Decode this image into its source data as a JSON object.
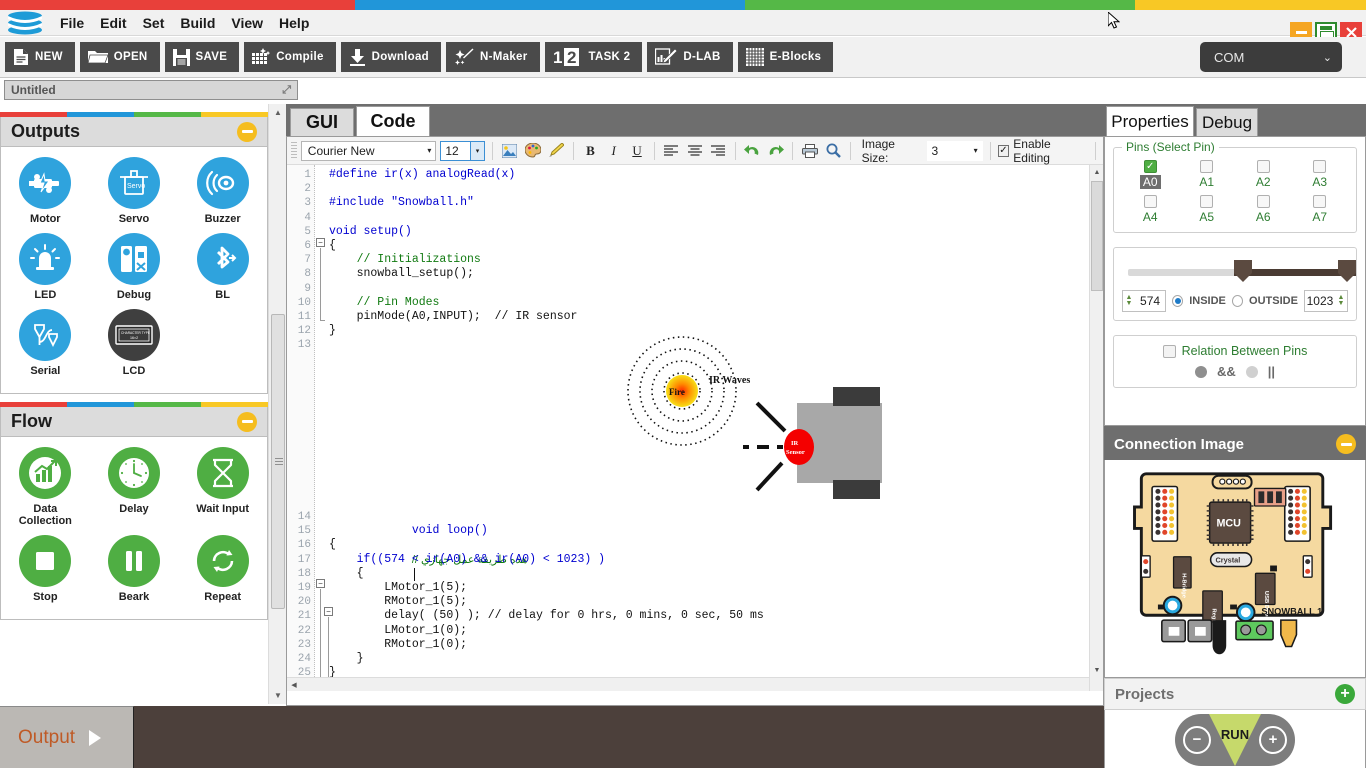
{
  "window": {
    "minimize_label": "–",
    "maximize_label": "□",
    "close_label": "✕"
  },
  "menubar": {
    "items": [
      {
        "label": "File"
      },
      {
        "label": "Edit"
      },
      {
        "label": "Set"
      },
      {
        "label": "Build"
      },
      {
        "label": "View"
      },
      {
        "label": "Help"
      }
    ]
  },
  "toolbar": {
    "buttons": [
      {
        "label": "NEW",
        "icon": "new-file-icon"
      },
      {
        "label": "OPEN",
        "icon": "folder-icon"
      },
      {
        "label": "SAVE",
        "icon": "floppy-icon"
      },
      {
        "label": "Compile",
        "icon": "compile-grid-icon"
      },
      {
        "label": "Download",
        "icon": "download-icon"
      },
      {
        "label": "N-Maker",
        "icon": "wand-icon"
      },
      {
        "label": "TASK 2",
        "icon": "task-number-icon"
      },
      {
        "label": "D-LAB",
        "icon": "chart-pencil-icon"
      },
      {
        "label": "E-Blocks",
        "icon": "blocks-grid-icon"
      }
    ],
    "com": {
      "value": "COM",
      "chevron": "⌄"
    }
  },
  "file_tab": {
    "title": "Untitled",
    "resize_glyph": "⤢"
  },
  "left_panel": {
    "groups": [
      {
        "title": "Outputs",
        "collapse_icon": "minus-icon",
        "items": [
          {
            "label": "Motor",
            "icon": "motor-icon",
            "style": "blue"
          },
          {
            "label": "Servo",
            "icon": "servo-icon",
            "style": "blue"
          },
          {
            "label": "Buzzer",
            "icon": "buzzer-icon",
            "style": "blue"
          },
          {
            "label": "LED",
            "icon": "led-icon",
            "style": "blue"
          },
          {
            "label": "Debug",
            "icon": "debug-icon",
            "style": "blue"
          },
          {
            "label": "BL",
            "icon": "bluetooth-icon",
            "style": "blue"
          },
          {
            "label": "Serial",
            "icon": "serial-icon",
            "style": "blue"
          },
          {
            "label": "LCD",
            "icon": "lcd-icon",
            "style": "dark"
          }
        ]
      },
      {
        "title": "Flow",
        "collapse_icon": "minus-icon",
        "items": [
          {
            "label": "Data\nCollection",
            "icon": "data-collection-icon",
            "style": "green"
          },
          {
            "label": "Delay",
            "icon": "clock-icon",
            "style": "green"
          },
          {
            "label": "Wait Input",
            "icon": "hourglass-icon",
            "style": "green"
          },
          {
            "label": "Stop",
            "icon": "stop-square-icon",
            "style": "green"
          },
          {
            "label": "Beark",
            "icon": "pause-icon",
            "style": "green"
          },
          {
            "label": "Repeat",
            "icon": "repeat-arrows-icon",
            "style": "green"
          }
        ]
      }
    ]
  },
  "editor": {
    "tabs": [
      {
        "label": "GUI",
        "active": false
      },
      {
        "label": "Code",
        "active": true
      }
    ],
    "toolbar": {
      "font_family": "Courier New",
      "font_size": "12",
      "insert_image_icon": "insert-image-icon",
      "color_icon": "palette-icon",
      "highlight_icon": "brush-icon",
      "bold_label": "B",
      "italic_label": "I",
      "underline_label": "U",
      "align_left_icon": "align-left-icon",
      "align_center_icon": "align-center-icon",
      "align_right_icon": "align-right-icon",
      "undo_icon": "undo-icon",
      "redo_icon": "redo-icon",
      "print_icon": "print-icon",
      "zoom_icon": "magnifier-icon",
      "image_size_label": "Image Size:",
      "image_size_value": "3",
      "enable_editing_label": "Enable Editing",
      "enable_editing_checked": true,
      "check_glyph": "✓",
      "dropdown_glyph": "▾"
    },
    "line_numbers_top": [
      "1",
      "2",
      "3",
      "4",
      "5",
      "6",
      "7",
      "8",
      "9",
      "10",
      "11",
      "12",
      "13"
    ],
    "line_numbers_bottom": [
      "14",
      "15",
      "16",
      "17",
      "18",
      "19",
      "20",
      "21",
      "22",
      "23",
      "24",
      "25"
    ],
    "code_top": [
      "#define ir(x) analogRead(x)",
      "",
      "#include \"Snowball.h\"",
      "",
      "void setup()",
      "{",
      "    // Initializations",
      "    snowball_setup();",
      "",
      "    // Pin Modes",
      "    pinMode(A0,INPUT);  // IR sensor",
      "}",
      ""
    ],
    "code_bottom": [
      "void loop()",
      "",
      "{",
      "    if((574 < ir(A0) && ir(A0) < 1023) )",
      "    {",
      "        LMotor_1(5);",
      "        RMotor_1(5);",
      "        delay( (50) ); // delay for 0 hrs, 0 mins, 0 sec, 50 ms",
      "        LMotor_1(0);",
      "        RMotor_1(0);",
      "    }",
      "}"
    ],
    "arabic_comment": "هذه طريقة عمل جهازي //",
    "diagram": {
      "fire_label": "Fire",
      "waves_label": "IR Waves",
      "sensor_label_line1": "IR",
      "sensor_label_line2": "Sensor"
    }
  },
  "properties": {
    "tabs": [
      {
        "label": "Properties",
        "active": true
      },
      {
        "label": "Debug",
        "active": false
      }
    ],
    "pins": {
      "legend": "Pins (Select Pin)",
      "check_glyph": "✓",
      "row1": [
        {
          "label": "A0",
          "checked": true,
          "selected": true
        },
        {
          "label": "A1",
          "checked": false,
          "selected": false
        },
        {
          "label": "A2",
          "checked": false,
          "selected": false
        },
        {
          "label": "A3",
          "checked": false,
          "selected": false
        }
      ],
      "row2": [
        {
          "label": "A4",
          "checked": false,
          "selected": false
        },
        {
          "label": "A5",
          "checked": false,
          "selected": false
        },
        {
          "label": "A6",
          "checked": false,
          "selected": false
        },
        {
          "label": "A7",
          "checked": false,
          "selected": false
        }
      ]
    },
    "range": {
      "min_value": "574",
      "max_value": "1023",
      "inside_label": "INSIDE",
      "outside_label": "OUTSIDE",
      "inside_selected": true,
      "up_glyph": "▲",
      "down_glyph": "▼"
    },
    "relation": {
      "checkbox_label": "Relation Between Pins",
      "checked": false,
      "and_label": "&&",
      "or_label": "||",
      "and_selected": true
    }
  },
  "connection_image": {
    "title": "Connection Image",
    "collapse_icon": "minus-icon",
    "board": {
      "mcu_label": "MCU",
      "crystal_label": "Crystal",
      "hbridge_label": "H-Bridge",
      "regulator_label": "Regulator",
      "usb_driver_label": "USB Driver",
      "board_name": "SNOWBALL 1"
    }
  },
  "projects": {
    "title": "Projects",
    "add_icon": "plus-icon"
  },
  "run": {
    "label": "RUN",
    "minus_label": "⊖",
    "plus_label": "⊕"
  },
  "output": {
    "label": "Output",
    "expand_icon": "play-triangle-icon"
  },
  "colors": {
    "red": "#e8403a",
    "blue": "#2196d9",
    "green": "#55b847",
    "yellow": "#f8c825",
    "accent_blue": "#2fa3dd",
    "accent_green": "#4fae43",
    "dark_toolbar": "#4a4a4a",
    "panel_gray": "#6e6e6e",
    "output_brown": "#4c403b",
    "output_text": "#bf5a26"
  }
}
